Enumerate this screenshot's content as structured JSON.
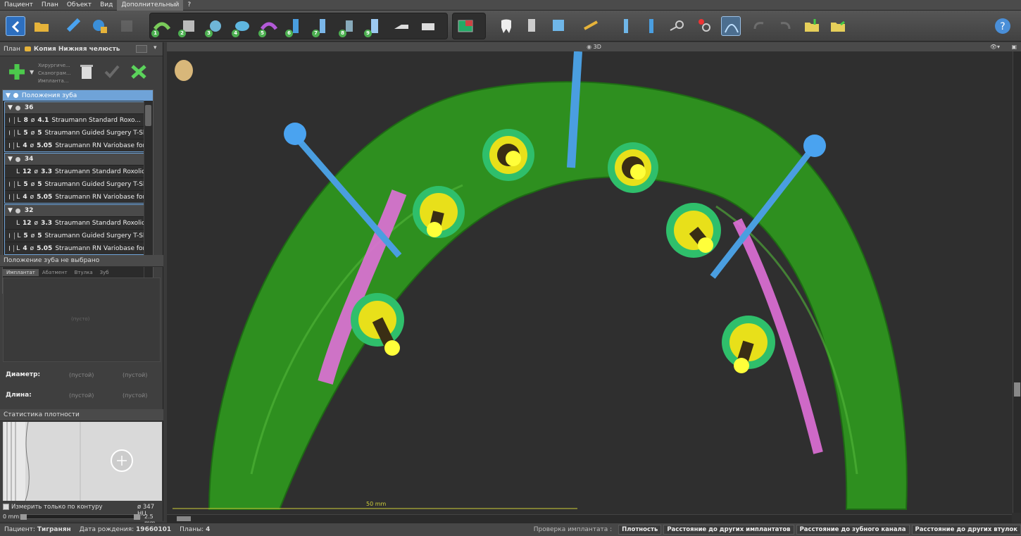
{
  "menu": [
    "Пациент",
    "План",
    "Объект",
    "Вид",
    "Дополнительный",
    "?"
  ],
  "menu_active_index": 4,
  "left_panel": {
    "plan_label": "План",
    "plan_name": "Копия Нижняя челюсть",
    "add_menu": [
      "Хирургиче...",
      "Сканограм...",
      "Импланта..."
    ],
    "tree_title": "Положения зуба",
    "groups": [
      {
        "tooth": "36",
        "rows": [
          {
            "L": "8",
            "d": "4.1",
            "name": "Straumann Standard Roxo...",
            "warn": true
          },
          {
            "L": "5",
            "d": "5",
            "name": "Straumann Guided Surgery T-Sl..."
          },
          {
            "L": "4",
            "d": "5.05",
            "name": "Straumann RN Variobase for..."
          }
        ]
      },
      {
        "tooth": "34",
        "rows": [
          {
            "L": "12",
            "d": "3.3",
            "name": "Straumann Standard Roxolid..."
          },
          {
            "L": "5",
            "d": "5",
            "name": "Straumann Guided Surgery T-Sl..."
          },
          {
            "L": "4",
            "d": "5.05",
            "name": "Straumann RN Variobase for..."
          }
        ]
      },
      {
        "tooth": "32",
        "rows": [
          {
            "L": "12",
            "d": "3.3",
            "name": "Straumann Standard Roxolid..."
          },
          {
            "L": "5",
            "d": "5",
            "name": "Straumann Guided Surgery T-Sl..."
          },
          {
            "L": "4",
            "d": "5.05",
            "name": "Straumann RN Variobase for..."
          }
        ]
      }
    ],
    "selection_header": "Положение зуба не выбрано",
    "tabs": [
      "Имплантат",
      "Абатмент",
      "Втулка",
      "Зуб"
    ],
    "placeholder_text": "(пусто)",
    "diameter_label": "Диаметр:",
    "length_label": "Длина:",
    "empty_value": "(пустой)",
    "density_header": "Статистика плотности",
    "measure_contour_label": "Измерить только по контуру",
    "density_value": "ø 347 HU",
    "slider_min": "0 mm",
    "slider_max": "2.5 mm"
  },
  "viewport": {
    "title": "3D",
    "scale_label": "50 mm"
  },
  "status": {
    "patient_label": "Пациент:",
    "patient_name": "Тигранян",
    "dob_label": "Дата рождения:",
    "dob": "19660101",
    "plans_label": "Планы:",
    "plans_count": "4",
    "check_label": "Проверка имплантата :",
    "buttons": [
      "Плотность",
      "Расстояние до других имплантатов",
      "Расстояние до зубного канала",
      "Расстояние до других втулок"
    ]
  },
  "colors": {
    "bone": "#2e8f1f",
    "implant_ring": "#2fbf6b",
    "abutment": "#e8e01a",
    "nerve": "#e070d8",
    "drill_guide": "#4a9ee0",
    "accent": "#6fa3d8"
  }
}
